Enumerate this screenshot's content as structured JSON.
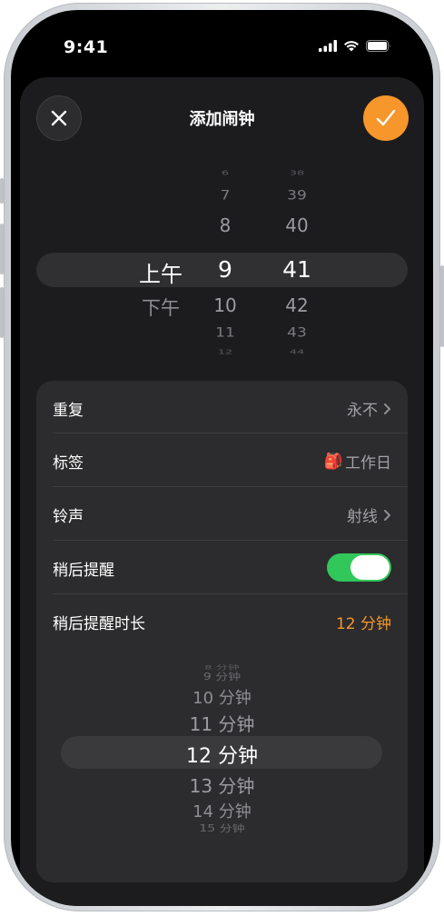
{
  "status_bar": {
    "time": "9:41"
  },
  "header": {
    "title": "添加闹钟",
    "close_icon": "close-icon",
    "confirm_icon": "checkmark-icon",
    "accent_color": "#f6962b"
  },
  "time_picker": {
    "period": {
      "items": [
        "",
        "",
        "",
        "上午",
        "下午",
        "",
        ""
      ],
      "selected": "上午"
    },
    "hour": {
      "items": [
        "6",
        "7",
        "8",
        "9",
        "10",
        "11",
        "12"
      ],
      "selected": "9"
    },
    "minute": {
      "items": [
        "38",
        "39",
        "40",
        "41",
        "42",
        "43",
        "44"
      ],
      "selected": "41"
    }
  },
  "settings": {
    "repeat": {
      "label": "重复",
      "value": "永不"
    },
    "label": {
      "label": "标签",
      "emoji": "🎒",
      "value": "工作日"
    },
    "sound": {
      "label": "铃声",
      "value": "射线"
    },
    "snooze": {
      "label": "稍后提醒",
      "enabled": true,
      "on_color": "#31c75a"
    },
    "snooze_duration": {
      "label": "稍后提醒时长",
      "value": "12 分钟",
      "value_color": "#f6962b"
    }
  },
  "snooze_picker": {
    "items": [
      "8 分钟",
      "9 分钟",
      "10 分钟",
      "11 分钟",
      "12 分钟",
      "13 分钟",
      "14 分钟",
      "15 分钟"
    ],
    "selected": "12 分钟"
  }
}
